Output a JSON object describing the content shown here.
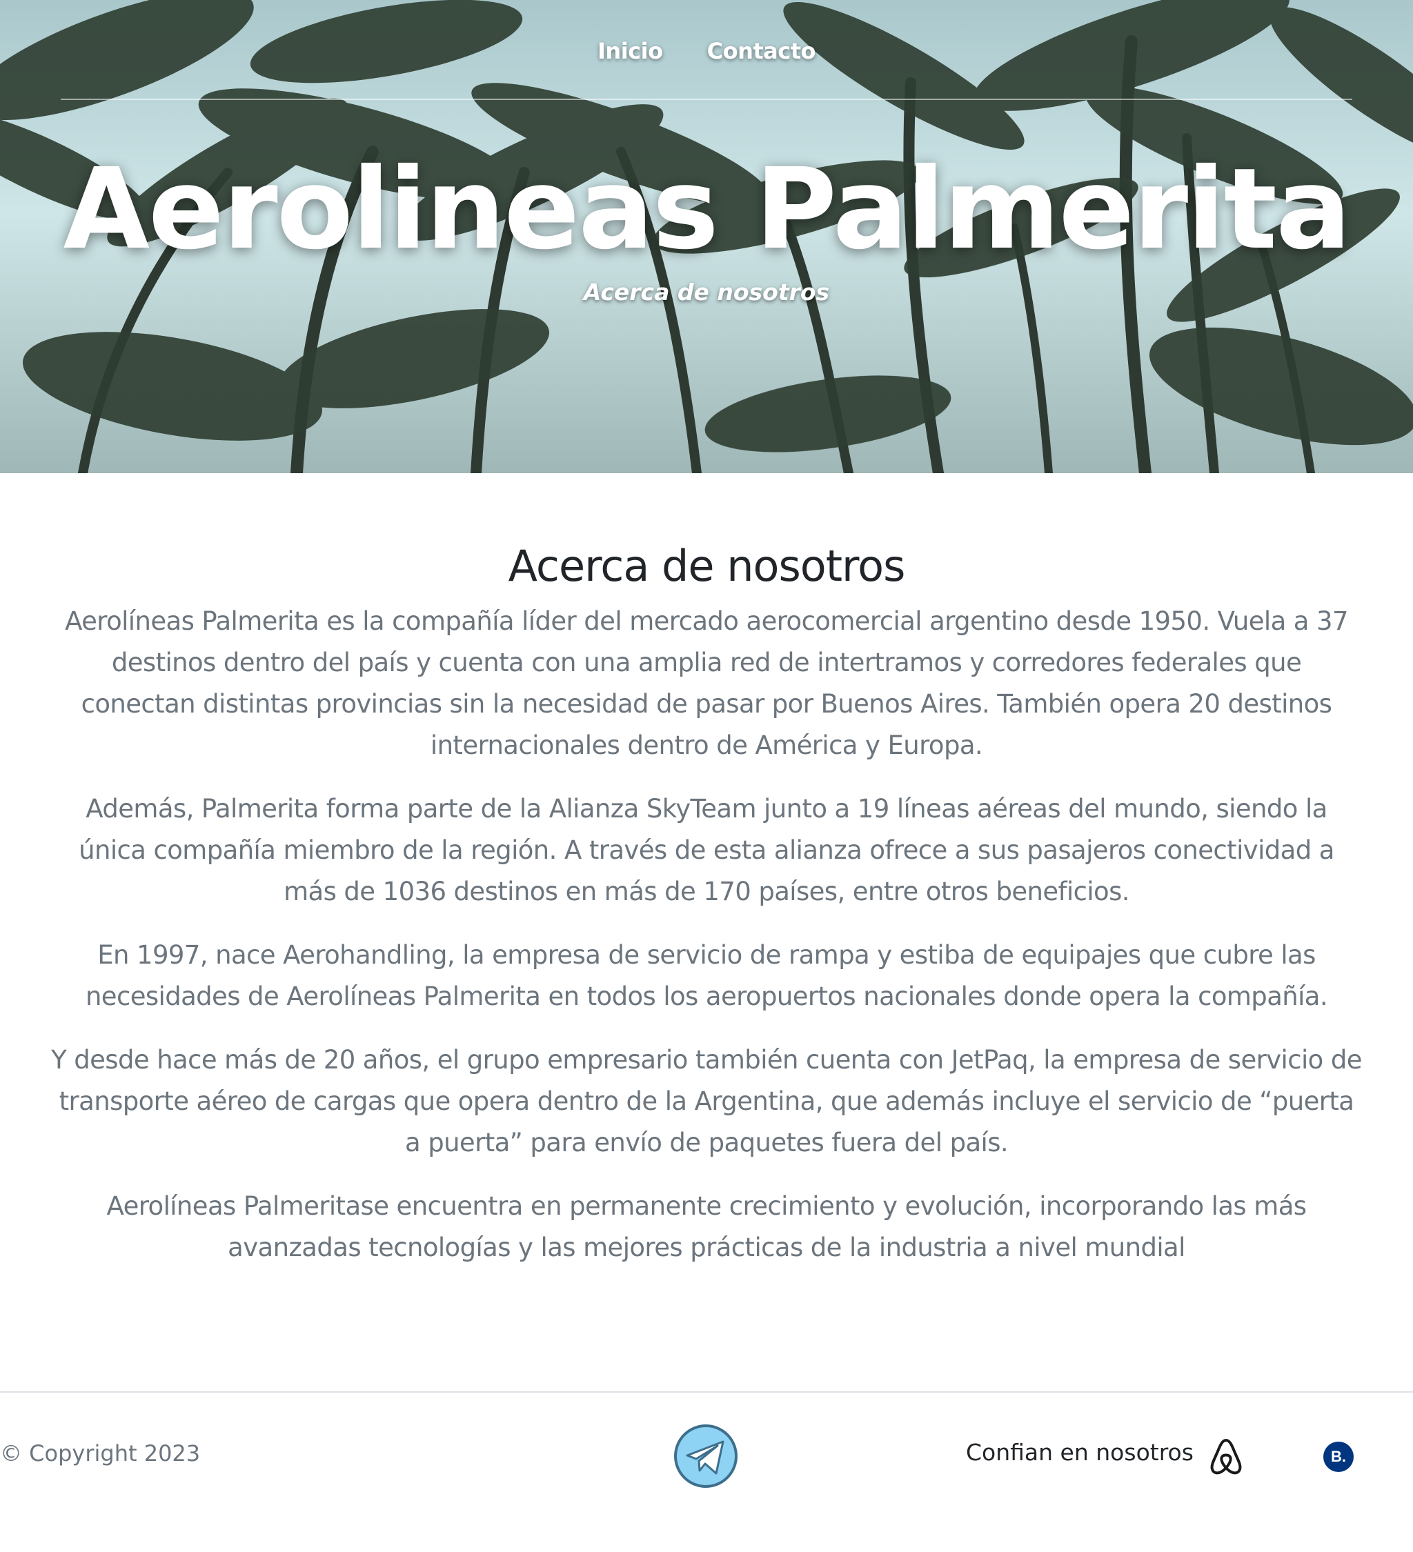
{
  "nav": {
    "items": [
      {
        "label": "Inicio"
      },
      {
        "label": "Contacto"
      }
    ]
  },
  "hero": {
    "title": "Aerolineas Palmerita",
    "subtitle": "Acerca de nosotros"
  },
  "about": {
    "heading": "Acerca de nosotros",
    "paragraphs": [
      "Aerolíneas Palmerita es la compañía líder del mercado aerocomercial argentino desde 1950. Vuela a 37 destinos dentro del país y cuenta con una amplia red de intertramos y corredores federales que conectan distintas provincias sin la necesidad de pasar por Buenos Aires. También opera 20 destinos internacionales dentro de América y Europa.",
      "Además, Palmerita forma parte de la Alianza SkyTeam junto a 19 líneas aéreas del mundo, siendo la única compañía miembro de la región. A través de esta alianza ofrece a sus pasajeros conectividad a más de 1036 destinos en más de 170 países, entre otros beneficios.",
      "En 1997, nace Aerohandling, la empresa de servicio de rampa y estiba de equipajes que cubre las necesidades de Aerolíneas Palmerita en todos los aeropuertos nacionales donde opera la compañía.",
      "Y desde hace más de 20 años, el grupo empresario también cuenta con JetPaq, la empresa de servicio de transporte aéreo de cargas que opera dentro de la Argentina, que además incluye el servicio de “puerta a puerta” para envío de paquetes fuera del país.",
      "Aerolíneas Palmeritase encuentra en permanente crecimiento y evolución, incorporando las más avanzadas tecnologías y las mejores prácticas de la industria a nivel mundial"
    ]
  },
  "footer": {
    "copyright": "© Copyright 2023",
    "trust_label": "Confian en nosotros",
    "booking_label": "B.",
    "icons": [
      "telegram-icon",
      "airbnb-icon",
      "booking-icon"
    ]
  },
  "colors": {
    "text_muted": "#6c757d",
    "text_dark": "#212529",
    "booking_blue": "#003580",
    "telegram_blue": "#8fd3f4"
  }
}
